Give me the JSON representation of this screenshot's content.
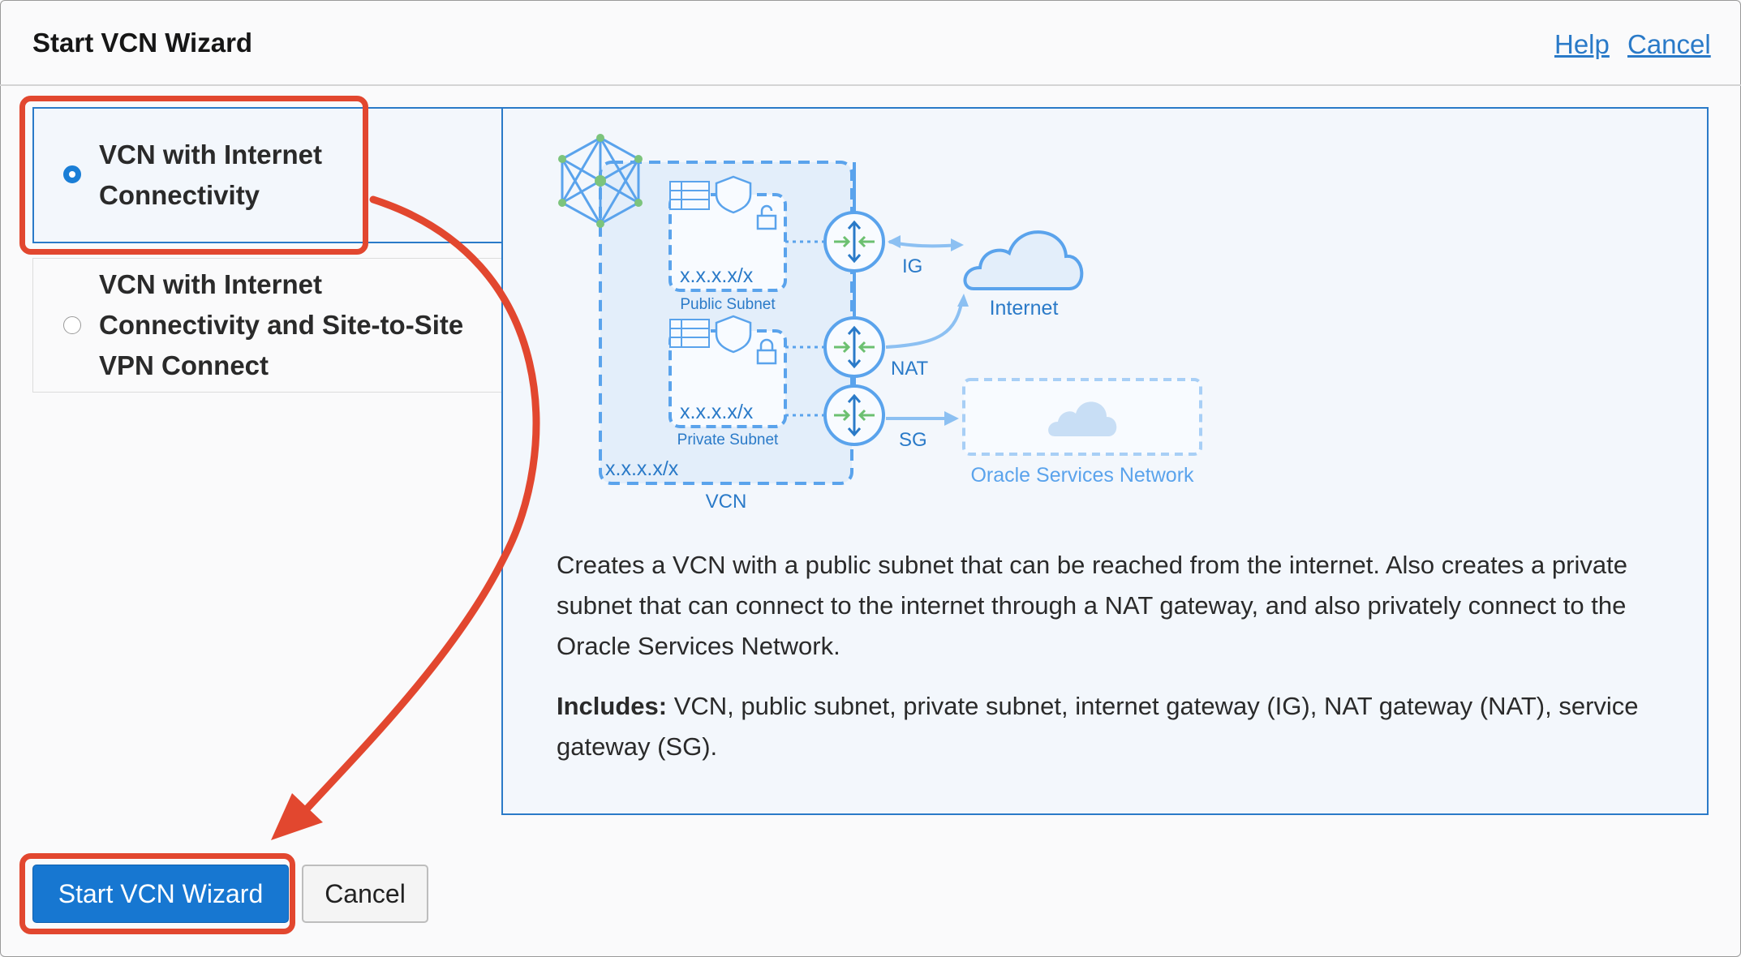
{
  "dialog": {
    "title": "Start VCN Wizard",
    "help_link": "Help",
    "cancel_link": "Cancel"
  },
  "options": [
    {
      "label_line1": "VCN with Internet",
      "label_line2": "Connectivity",
      "selected": true
    },
    {
      "label_line1": "VCN with Internet",
      "label_line2": "Connectivity and Site-to-Site",
      "label_line3": "VPN Connect",
      "selected": false
    }
  ],
  "diagram": {
    "vcn_cidr": "x.x.x.x/x",
    "vcn_label": "VCN",
    "public_cidr": "x.x.x.x/x",
    "public_subnet": "Public Subnet",
    "private_cidr": "x.x.x.x/x",
    "private_subnet": "Private Subnet",
    "ig": "IG",
    "nat": "NAT",
    "sg": "SG",
    "internet": "Internet",
    "osn": "Oracle Services Network"
  },
  "description": "Creates a VCN with a public subnet that can be reached from the internet. Also creates a private subnet that can connect to the internet through a NAT gateway, and also privately connect to the Oracle Services Network.",
  "includes": {
    "label": "Includes:",
    "text": " VCN, public subnet, private subnet, internet gateway (IG), NAT gateway (NAT), service gateway (SG)."
  },
  "footer": {
    "start_button": "Start VCN Wizard",
    "cancel_button": "Cancel"
  },
  "colors": {
    "accent": "#1777d1",
    "annotation": "#e2472f",
    "diagram_blue": "#5aa3ec"
  }
}
